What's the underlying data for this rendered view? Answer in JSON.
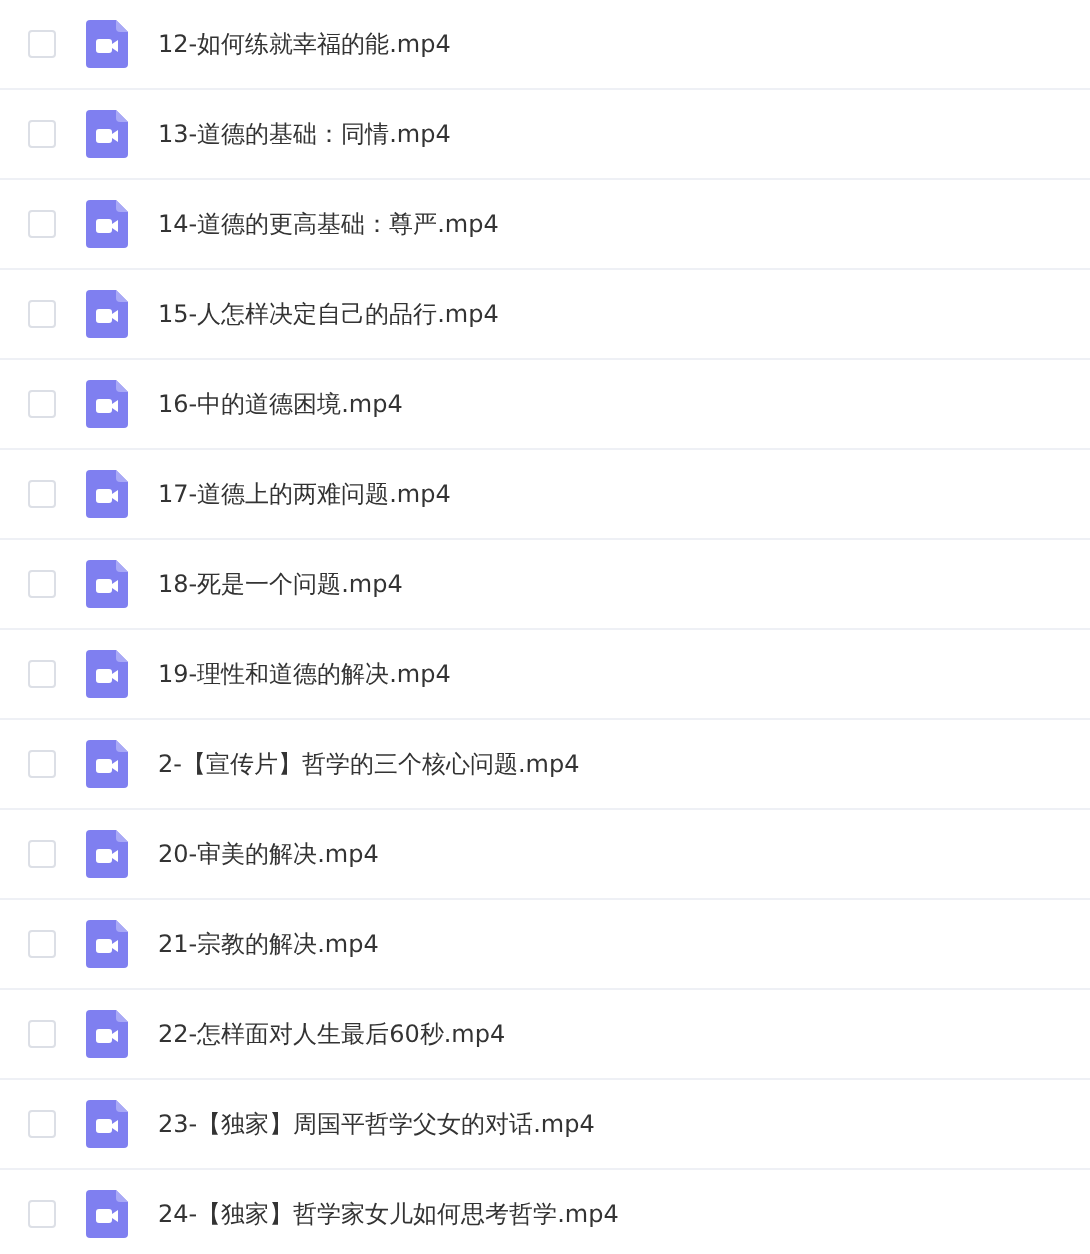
{
  "files": [
    {
      "name": "12-如何练就幸福的能.mp4",
      "checked": false
    },
    {
      "name": "13-道德的基础：同情.mp4",
      "checked": false
    },
    {
      "name": "14-道德的更高基础：尊严.mp4",
      "checked": false
    },
    {
      "name": "15-人怎样决定自己的品行.mp4",
      "checked": false
    },
    {
      "name": "16-中的道德困境.mp4",
      "checked": false
    },
    {
      "name": "17-道德上的两难问题.mp4",
      "checked": false
    },
    {
      "name": "18-死是一个问题.mp4",
      "checked": false
    },
    {
      "name": "19-理性和道德的解决.mp4",
      "checked": false
    },
    {
      "name": "2-【宣传片】哲学的三个核心问题.mp4",
      "checked": false
    },
    {
      "name": "20-审美的解决.mp4",
      "checked": false
    },
    {
      "name": "21-宗教的解决.mp4",
      "checked": false
    },
    {
      "name": "22-怎样面对人生最后60秒.mp4",
      "checked": false
    },
    {
      "name": "23-【独家】周国平哲学父女的对话.mp4",
      "checked": false
    },
    {
      "name": "24-【独家】哲学家女儿如何思考哲学.mp4",
      "checked": false
    }
  ]
}
